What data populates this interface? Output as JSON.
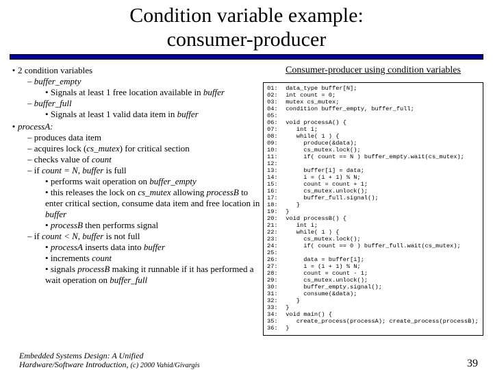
{
  "title_line1": "Condition variable example:",
  "title_line2": "consumer-producer",
  "left": {
    "h1": "2 condition variables",
    "be": "buffer_empty",
    "be_detail_pre": "Signals at least 1 free location available in ",
    "be_detail_ital": "buffer",
    "bf": "buffer_full",
    "bf_detail_pre": "Signals at least 1 valid data item in ",
    "bf_detail_ital": "buffer",
    "h2": "processA:",
    "a1": "produces data item",
    "a2_pre": "acquires lock (",
    "a2_ital": "cs_mutex",
    "a2_post": ") for critical section",
    "a3_pre": "checks value of ",
    "a3_ital": "count",
    "a4_pre": "if ",
    "a4_cond": "count = N, buffer",
    "a4_post": " is full",
    "a4s1_pre": "performs wait operation on ",
    "a4s1_ital": "buffer_empty",
    "a4s2_pre": "this releases the lock on ",
    "a4s2_ital": "cs_mutex",
    "a4s2_post1": " allowing ",
    "a4s2_ital2": "processB",
    "a4s2_post2": " to enter critical section, consume data item and free location in ",
    "a4s2_ital3": "buffer",
    "a4s3_ital": "processB",
    "a4s3_post": " then performs signal",
    "a5_pre": "if ",
    "a5_cond": "count < N, buffer",
    "a5_post": " is not full",
    "a5s1_ital": "processA",
    "a5s1_post_pre": " inserts data into ",
    "a5s1_post_ital": "buffer",
    "a5s2_pre": "increments ",
    "a5s2_ital": "count",
    "a5s3_pre": "signals ",
    "a5s3_ital": "processB",
    "a5s3_post_pre": " making it runnable if it has performed a wait operation on ",
    "a5s3_post_ital": "buffer_full"
  },
  "right": {
    "heading": "Consumer-producer using condition variables",
    "code": [
      "data_type buffer[N];",
      "int count = 0;",
      "mutex cs_mutex;",
      "condition buffer_empty, buffer_full;",
      "",
      "void processA() {",
      "   int i;",
      "   while( 1 ) {",
      "     produce(&data);",
      "     cs_mutex.lock();",
      "     if( count == N ) buffer_empty.wait(cs_mutex);",
      "",
      "     buffer[i] = data;",
      "     i = (i + 1) % N;",
      "     count = count + 1;",
      "     cs_mutex.unlock();",
      "     buffer_full.signal();",
      "   }",
      "}",
      "void processB() {",
      "   int i;",
      "   while( 1 ) {",
      "     cs_mutex.lock();",
      "     if( count == 0 ) buffer_full.wait(cs_mutex);",
      "",
      "     data = buffer[i];",
      "     i = (i + 1) % N;",
      "     count = count - 1;",
      "     cs_mutex.unlock();",
      "     buffer_empty.signal();",
      "     consume(&data);",
      "   }",
      "}",
      "void main() {",
      "   create_process(processA); create_process(processB);",
      "}"
    ]
  },
  "footer": {
    "line1": "Embedded Systems Design: A Unified",
    "line2_pre": "Hardware/Software Introduction, ",
    "line2_small": "(c) 2000 Vahid/Givargis",
    "page": "39"
  }
}
